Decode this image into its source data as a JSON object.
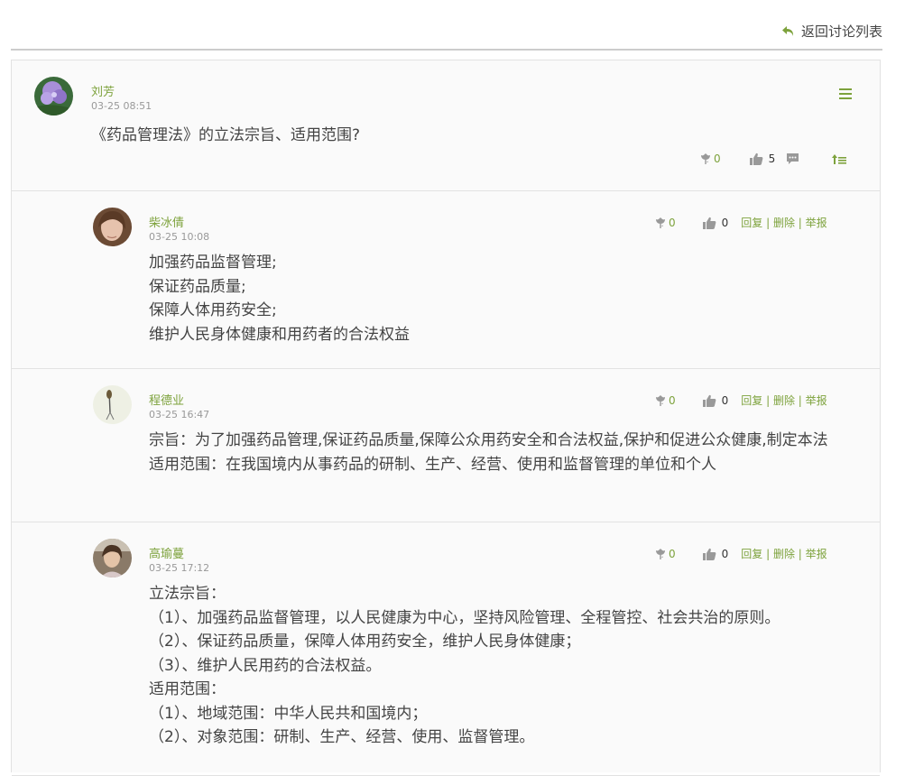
{
  "header": {
    "back_label": "返回讨论列表"
  },
  "main_post": {
    "author": "刘芳",
    "time": "03-25 08:51",
    "content": "《药品管理法》的立法宗旨、适用范围?",
    "flower_count": "0",
    "like_count": "5"
  },
  "replies": [
    {
      "author": "柴冰倩",
      "time": "03-25 10:08",
      "flower_count": "0",
      "like_count": "0",
      "lines": [
        "加强药品监督管理;",
        "保证药品质量;",
        "保障人体用药安全;",
        "维护人民身体健康和用药者的合法权益"
      ]
    },
    {
      "author": "程德业",
      "time": "03-25 16:47",
      "flower_count": "0",
      "like_count": "0",
      "lines": [
        "宗旨：为了加强药品管理,保证药品质量,保障公众用药安全和合法权益,保护和促进公众健康,制定本法",
        "适用范围：在我国境内从事药品的研制、生产、经营、使用和监督管理的单位和个人"
      ]
    },
    {
      "author": "高瑜蔓",
      "time": "03-25 17:12",
      "flower_count": "0",
      "like_count": "0",
      "lines": [
        "立法宗旨：",
        "（1）、加强药品监督管理，以人民健康为中心，坚持风险管理、全程管控、社会共治的原则。",
        "（2）、保证药品质量，保障人体用药安全，维护人民身体健康；",
        "（3）、维护人民用药的合法权益。",
        "适用范围：",
        "（1）、地域范围：中华人民共和国境内；",
        "（2）、对象范围：研制、生产、经营、使用、监督管理。"
      ]
    }
  ],
  "reply_actions": {
    "reply": "回复",
    "delete": "删除",
    "report": "举报",
    "separator": " | "
  },
  "icons": {
    "back": "back-arrow-icon",
    "menu": "menu-icon",
    "flower": "flower-icon",
    "like": "thumbs-up-icon",
    "comment": "comment-icon",
    "top": "pin-top-icon"
  },
  "colors": {
    "accent": "#7da23c",
    "icon_gray": "#999999",
    "border": "#e2e2e2",
    "background": "#fafafa"
  }
}
